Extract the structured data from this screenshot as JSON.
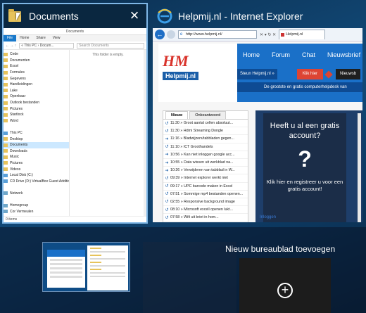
{
  "windows": {
    "explorer": {
      "title": "Documents",
      "close_icon": "×",
      "window_title": "Documents",
      "ribbon_tabs": [
        "File",
        "Home",
        "Share",
        "View"
      ],
      "address": "« This PC › Docum...",
      "search_placeholder": "Search Documents",
      "nav_items": [
        {
          "label": "Cede",
          "type": "folder"
        },
        {
          "label": "Documenten",
          "type": "folder"
        },
        {
          "label": "Excel",
          "type": "folder"
        },
        {
          "label": "Formules",
          "type": "folder"
        },
        {
          "label": "Gegevens",
          "type": "folder"
        },
        {
          "label": "Handleidingen",
          "type": "folder"
        },
        {
          "label": "Lake",
          "type": "folder"
        },
        {
          "label": "Openbaar",
          "type": "folder"
        },
        {
          "label": "Outlook bestanden",
          "type": "folder"
        },
        {
          "label": "Pictures",
          "type": "folder"
        },
        {
          "label": "Startlock",
          "type": "folder"
        },
        {
          "label": "Word",
          "type": "folder"
        },
        {
          "label": "",
          "type": "spacer"
        },
        {
          "label": "This PC",
          "type": "pc"
        },
        {
          "label": "Desktop",
          "type": "folder"
        },
        {
          "label": "Documents",
          "type": "folder",
          "selected": true
        },
        {
          "label": "Downloads",
          "type": "folder"
        },
        {
          "label": "Music",
          "type": "folder"
        },
        {
          "label": "Pictures",
          "type": "folder"
        },
        {
          "label": "Videos",
          "type": "folder"
        },
        {
          "label": "Local Disk (C:)",
          "type": "pc"
        },
        {
          "label": "CD Drive (D:) VirtualBox Guest Additions",
          "type": "pc"
        },
        {
          "label": "",
          "type": "spacer"
        },
        {
          "label": "Network",
          "type": "net"
        },
        {
          "label": "",
          "type": "spacer"
        },
        {
          "label": "Homegroup",
          "type": "net"
        },
        {
          "label": "Cor Vermeulen",
          "type": "net"
        }
      ],
      "empty_text": "This folder is empty.",
      "status": "0 items"
    },
    "ie": {
      "title": "Helpmij.nl - Internet Explorer",
      "address": "http://www.helpmij.nl/",
      "address_icons": "✕ ▾ ↻ ✕",
      "tab_label": "Helpmij.nl",
      "logo_main": "HM",
      "logo_sub": "Helpmij.nl",
      "nav": [
        "Home",
        "Forum",
        "Chat",
        "Nieuwsbrief"
      ],
      "steun": "Steun Helpmij.nl »",
      "klik_hier": "Klik hier",
      "nieuwsbrief_btn": "Nieuwsb",
      "tagline": "De grootste en gratis computerhelpdesk van",
      "news_tabs": [
        "Nieuw",
        "Onbeantwoord"
      ],
      "news": [
        {
          "icon": "↺",
          "text": "11:30 » Groot aantal cellen absoluut..."
        },
        {
          "icon": "↺",
          "text": "11:30 » Hdmi Streaming Dongle"
        },
        {
          "icon": "➜",
          "text": "11:16 » Bladwijzers/tabbladen gegen..."
        },
        {
          "icon": "↺",
          "text": "11:10 » ICT Groothandels"
        },
        {
          "icon": "➜",
          "text": "10:56 » Kan niet inloggen google acc..."
        },
        {
          "icon": "➜",
          "text": "10:55 » Data wissen uit werkblad na..."
        },
        {
          "icon": "➜",
          "text": "10:26 » Verwijderen van tabblad in W..."
        },
        {
          "icon": "↺",
          "text": "09:39 » Internet explorer werkt niet"
        },
        {
          "icon": "↺",
          "text": "09:17 » UPC barcode maken in Excel"
        },
        {
          "icon": "↺",
          "text": "07:51 » Sommige mp4 bestanden openen..."
        },
        {
          "icon": "↺",
          "text": "02:55 » Responsive background image"
        },
        {
          "icon": "↺",
          "text": "08:10 » Microsoft excell openen lukt..."
        },
        {
          "icon": "↺",
          "text": "07:58 » Wifi uit briet in hom..."
        }
      ],
      "ad_heading": "Heeft u al een gratis account?",
      "ad_question": "?",
      "ad_footer": "Klik hier en registreer u voor een gratis account!",
      "inloggen": "Inloggen"
    }
  },
  "desktops": {
    "new_desktop_label": "Nieuw bureaublad toevoegen",
    "plus_icon": "+"
  },
  "colors": {
    "accent": "#1a70c8",
    "ad_background": "#1b2d48",
    "helpmij_red": "#d9332b"
  }
}
